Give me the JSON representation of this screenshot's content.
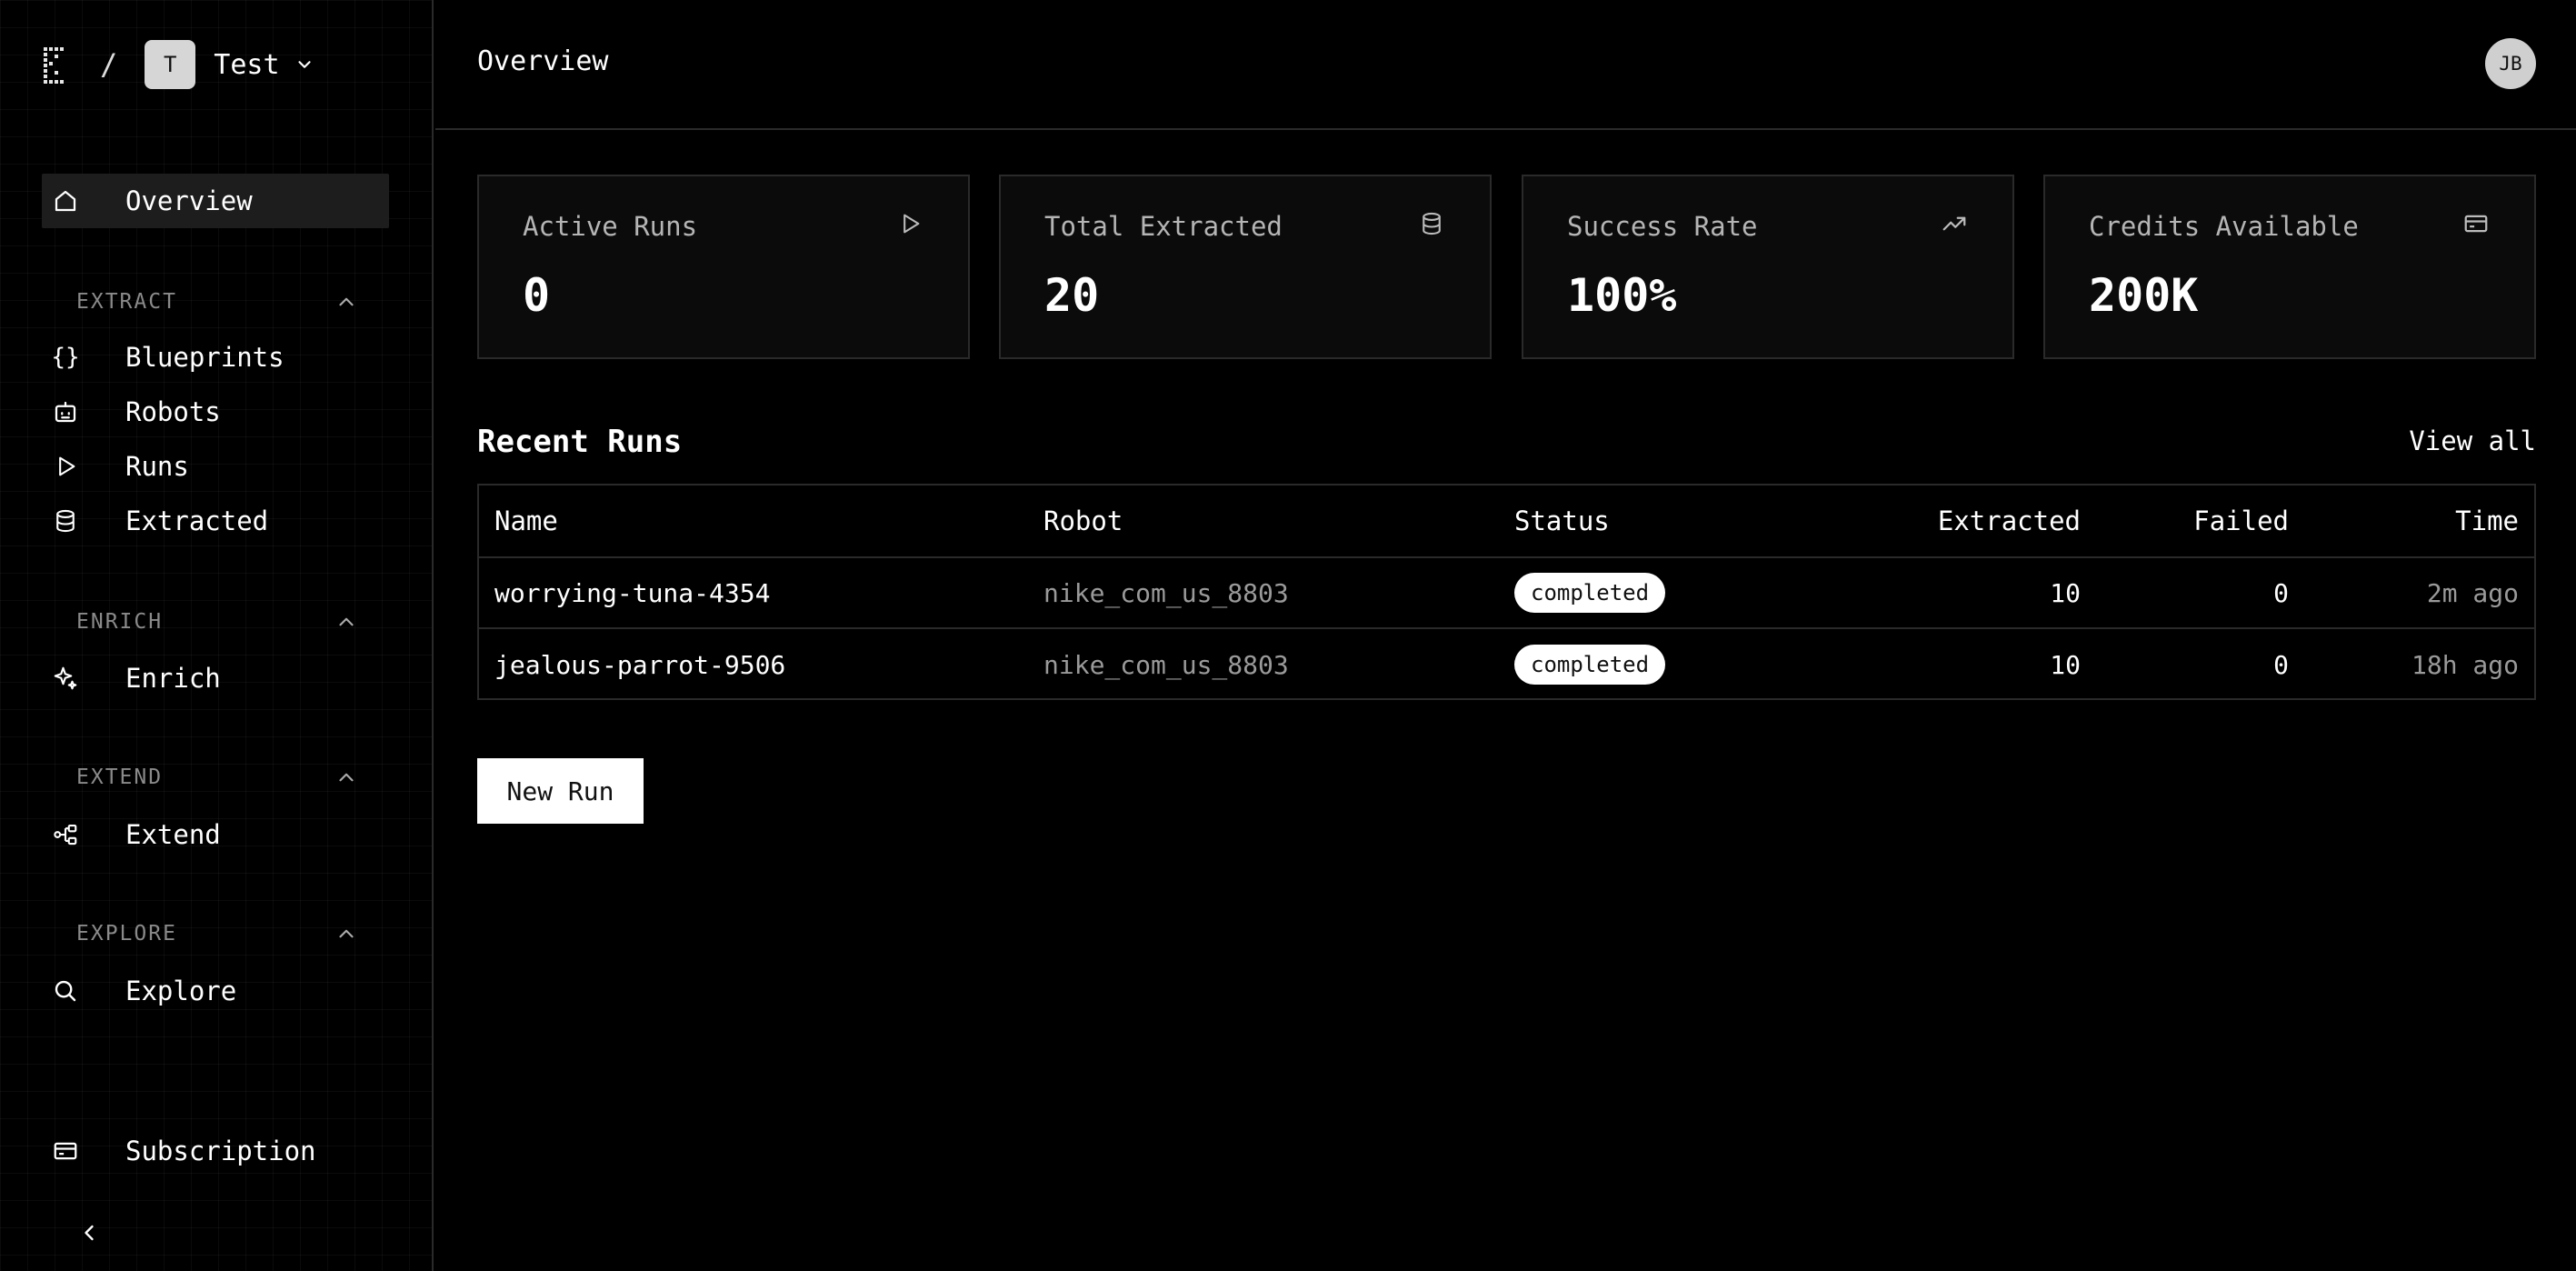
{
  "workspace": {
    "badge": "T",
    "name": "Test",
    "slash": "/"
  },
  "header": {
    "title": "Overview",
    "avatar": "JB"
  },
  "sidebar": {
    "overview": "Overview",
    "sections": {
      "extract": {
        "label": "EXTRACT",
        "items": [
          "Blueprints",
          "Robots",
          "Runs",
          "Extracted"
        ]
      },
      "enrich": {
        "label": "ENRICH",
        "items": [
          "Enrich"
        ]
      },
      "extend": {
        "label": "EXTEND",
        "items": [
          "Extend"
        ]
      },
      "explore": {
        "label": "EXPLORE",
        "items": [
          "Explore"
        ]
      }
    },
    "subscription": "Subscription",
    "braces_glyph": "{}"
  },
  "stats": [
    {
      "title": "Active Runs",
      "value": "0",
      "icon": "play-icon"
    },
    {
      "title": "Total Extracted",
      "value": "20",
      "icon": "database-icon"
    },
    {
      "title": "Success Rate",
      "value": "100%",
      "icon": "trending-up-icon"
    },
    {
      "title": "Credits Available",
      "value": "200K",
      "icon": "credit-card-icon"
    }
  ],
  "recent_runs": {
    "title": "Recent Runs",
    "view_all": "View all",
    "columns": [
      "Name",
      "Robot",
      "Status",
      "Extracted",
      "Failed",
      "Time"
    ],
    "rows": [
      {
        "name": "worrying-tuna-4354",
        "robot": "nike_com_us_8803",
        "status": "completed",
        "extracted": "10",
        "failed": "0",
        "time": "2m ago"
      },
      {
        "name": "jealous-parrot-9506",
        "robot": "nike_com_us_8803",
        "status": "completed",
        "extracted": "10",
        "failed": "0",
        "time": "18h ago"
      }
    ]
  },
  "actions": {
    "new_run": "New Run"
  },
  "colors": {
    "background": "#000000",
    "card": "#0b0b0b",
    "border": "#2a2a2a",
    "muted_text": "#9a9a9a",
    "pill": "#ffffff"
  }
}
